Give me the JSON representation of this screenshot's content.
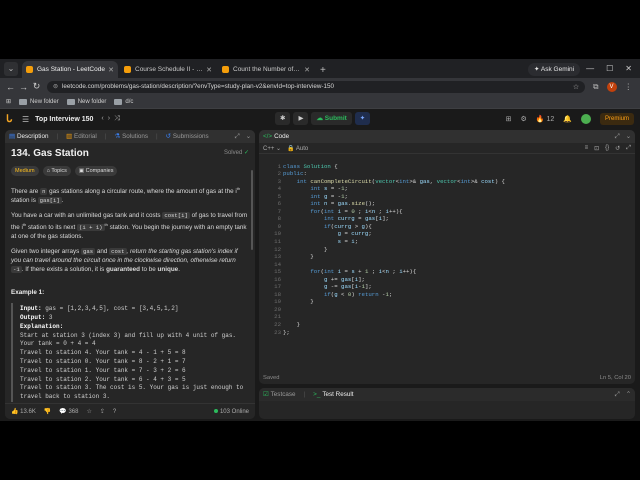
{
  "browser": {
    "tabs": [
      {
        "title": "Gas Station - LeetCode"
      },
      {
        "title": "Course Schedule II - LeetCode"
      },
      {
        "title": "Count the Number of Complete"
      }
    ],
    "ask_gemini": "Ask Gemini",
    "url": "leetcode.com/problems/gas-station/description/?envType=study-plan-v2&envId=top-interview-150",
    "profile_initial": "V",
    "bookmarks": [
      "New folder",
      "New folder",
      "d/c"
    ]
  },
  "leetcode": {
    "list_title": "Top Interview 150",
    "submit_label": "Submit",
    "streak_count": "12",
    "premium_label": "Premium"
  },
  "left_panel": {
    "tabs": {
      "description": "Description",
      "editorial": "Editorial",
      "solutions": "Solutions",
      "submissions": "Submissions"
    },
    "title": "134. Gas Station",
    "solved": "Solved",
    "chips": {
      "difficulty": "Medium",
      "topics": "Topics",
      "companies": "Companies"
    },
    "p1": {
      "a": "There are",
      "n": "n",
      "b": "gas stations along a circular route, where the amount of gas at the",
      "ith": "i",
      "th": "th",
      "c": "station is",
      "code": "gas[i]",
      "d": "."
    },
    "p2": {
      "a": "You have a car with an unlimited gas tank and it costs",
      "code1": "cost[i]",
      "b": "of gas to travel from the",
      "c": "station to its next",
      "code2": "(i + 1)",
      "d": "station. You begin the journey with an empty tank at one of the gas stations."
    },
    "p3": {
      "a": "Given two integer arrays",
      "code1": "gas",
      "b": "and",
      "code2": "cost",
      "c": ", return the starting gas station's index if you can travel around the circuit once in the clockwise direction, otherwise return",
      "code3": "-1",
      "d": ". If there exists a solution, it is",
      "strong": "guaranteed",
      "e": "to be",
      "strong2": "unique",
      "f": "."
    },
    "example_heading": "Example 1:",
    "example": {
      "input_label": "Input:",
      "input_value": " gas = [1,2,3,4,5], cost = [3,4,5,1,2]",
      "output_label": "Output:",
      "output_value": " 3",
      "explanation_label": "Explanation:",
      "lines": [
        "Start at station 3 (index 3) and fill up with 4 unit of gas.",
        "Your tank = 0 + 4 = 4",
        "Travel to station 4. Your tank = 4 - 1 + 5 = 8",
        "Travel to station 0. Your tank = 8 - 2 + 1 = 7",
        "Travel to station 1. Your tank = 7 - 3 + 2 = 6",
        "Travel to station 2. Your tank = 6 - 4 + 3 = 5",
        "Travel to station 3. The cost is 5. Your gas is just enough to",
        "travel back to station 3."
      ]
    },
    "footer": {
      "likes": "13.6K",
      "comments": "368",
      "online": "103 Online"
    }
  },
  "editor": {
    "tab": "Code",
    "language": "C++",
    "mode": "Auto",
    "code_lines": [
      "class Solution {",
      "public:",
      "    int canCompleteCircuit(vector<int>& gas, vector<int>& cost) {",
      "        int s = -1;",
      "        int g = -1;",
      "        int n = gas.size();",
      "        for(int i = 0 ; i<n ; i++){",
      "            int currg = gas[i];",
      "            if(currg > g){",
      "                g = currg;",
      "                s = i;",
      "            }",
      "        }",
      "",
      "        for(int i = s + 1 ; i<n ; i++){",
      "            g += gas[i];",
      "            g -= gas[i-1];",
      "            if(g < 0) return -1;",
      "        }",
      "",
      "",
      "    }",
      "};"
    ],
    "status": "Saved",
    "cursor": "Ln 5, Col 20"
  },
  "bottom_panel": {
    "testcase": "Testcase",
    "test_result": "Test Result"
  }
}
